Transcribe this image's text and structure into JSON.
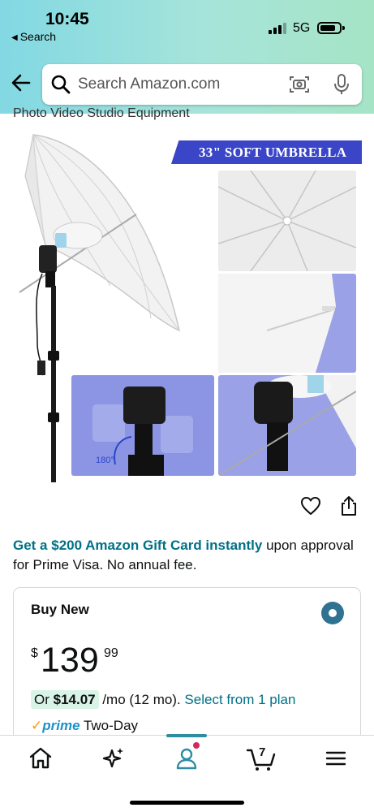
{
  "status_bar": {
    "time": "10:45",
    "back_label": "Search",
    "network": "5G"
  },
  "search": {
    "placeholder": "Search Amazon.com",
    "icons": [
      "search-icon",
      "camera-icon",
      "mic-icon"
    ]
  },
  "product": {
    "subtitle": "Photo Video Studio Equipment",
    "banner_text": "33\" SOFT UMBRELLA",
    "rotation_label": "180°"
  },
  "promo": {
    "link_text": "Get a $200 Amazon Gift Card instantly",
    "text": " upon approval for Prime Visa. No annual fee."
  },
  "buy_box": {
    "title": "Buy New",
    "price_symbol": "$",
    "price_whole": "139",
    "price_fraction": "99",
    "plan_prefix": "Or ",
    "plan_amount": "$14.07",
    "plan_terms": " /mo (12 mo). ",
    "plan_link": "Select from 1 plan",
    "prime_check": "✓",
    "prime_word": "prime",
    "delivery": " Two-Day"
  },
  "bottom_nav": {
    "items": [
      "home-icon",
      "rufus-sparkle-icon",
      "account-icon",
      "cart-icon",
      "menu-icon"
    ],
    "cart_count": "7"
  },
  "colors": {
    "accent_teal": "#007185",
    "banner_blue": "#3b45c8",
    "prime_blue": "#1d92c9",
    "prime_orange": "#ff9900",
    "badge_pink": "#d12a5c",
    "plan_chip_green": "#d9f3e6"
  }
}
